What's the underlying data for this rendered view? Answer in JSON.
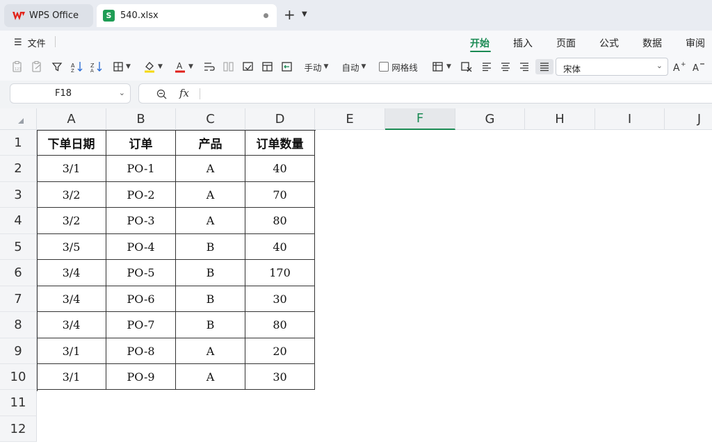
{
  "titlebar": {
    "app_tab_label": "WPS Office",
    "doc_tab_label": "540.xlsx",
    "doc_tab_badge": "S",
    "new_tab_symbol": "+",
    "new_tab_chevron": "⌄"
  },
  "menu": {
    "file_label": "文件",
    "tabs": [
      "开始",
      "插入",
      "页面",
      "公式",
      "数据",
      "审阅"
    ],
    "active_tab": "开始"
  },
  "toolbar": {
    "row_height_label": "手动",
    "col_width_label": "自动",
    "gridlines_label": "网格线",
    "font_name": "宋体"
  },
  "formula_bar": {
    "name_box": "F18",
    "fx_label": "fx",
    "formula": ""
  },
  "grid": {
    "columns": [
      "A",
      "B",
      "C",
      "D",
      "E",
      "F",
      "G",
      "H",
      "I",
      "J"
    ],
    "active_column": "F",
    "rows": [
      "1",
      "2",
      "3",
      "4",
      "5",
      "6",
      "7",
      "8",
      "9",
      "10",
      "11",
      "12"
    ]
  },
  "table": {
    "headers": [
      "下单日期",
      "订单",
      "产品",
      "订单数量"
    ],
    "rows": [
      [
        "3/1",
        "PO-1",
        "A",
        "40"
      ],
      [
        "3/2",
        "PO-2",
        "A",
        "70"
      ],
      [
        "3/2",
        "PO-3",
        "A",
        "80"
      ],
      [
        "3/5",
        "PO-4",
        "B",
        "40"
      ],
      [
        "3/4",
        "PO-5",
        "B",
        "170"
      ],
      [
        "3/4",
        "PO-6",
        "B",
        "30"
      ],
      [
        "3/4",
        "PO-7",
        "B",
        "80"
      ],
      [
        "3/1",
        "PO-8",
        "A",
        "20"
      ],
      [
        "3/1",
        "PO-9",
        "A",
        "30"
      ]
    ]
  },
  "colors": {
    "accent": "#1a8a53",
    "sheet_badge": "#1f9d55",
    "wps_logo": "#e2231a"
  }
}
